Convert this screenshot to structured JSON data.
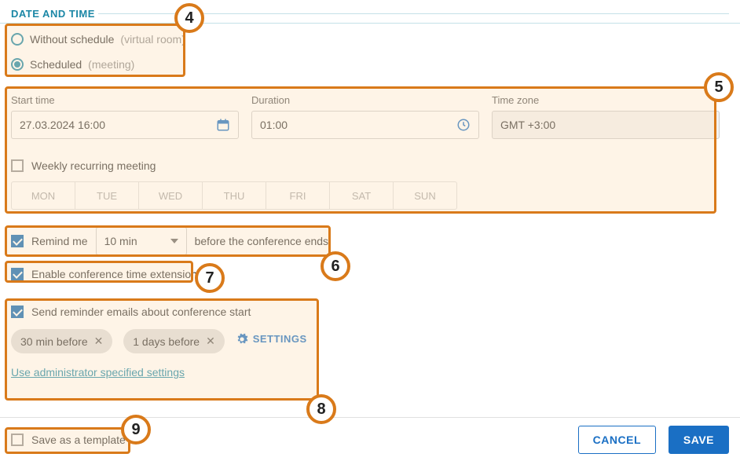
{
  "section": {
    "title": "DATE AND TIME"
  },
  "schedule": {
    "withoutLabel": "Without schedule",
    "withoutHint": "(virtual room)",
    "scheduledLabel": "Scheduled",
    "scheduledHint": "(meeting)"
  },
  "fields": {
    "startLabel": "Start time",
    "startValue": "27.03.2024 16:00",
    "durationLabel": "Duration",
    "durationValue": "01:00",
    "tzLabel": "Time zone",
    "tzValue": "GMT +3:00"
  },
  "recurring": {
    "label": "Weekly recurring meeting",
    "days": [
      "MON",
      "TUE",
      "WED",
      "THU",
      "FRI",
      "SAT",
      "SUN"
    ]
  },
  "remind": {
    "label": "Remind me",
    "value": "10 min",
    "suffix": "before the conference ends"
  },
  "extend": {
    "label": "Enable conference time extension"
  },
  "emails": {
    "label": "Send reminder emails about conference start",
    "chips": [
      "30 min before",
      "1 days before"
    ],
    "settings": "SETTINGS",
    "adminLink": "Use administrator specified settings"
  },
  "footer": {
    "templateLabel": "Save as a template",
    "cancel": "CANCEL",
    "save": "SAVE"
  },
  "badges": {
    "b4": "4",
    "b5": "5",
    "b6": "6",
    "b7": "7",
    "b8": "8",
    "b9": "9"
  }
}
